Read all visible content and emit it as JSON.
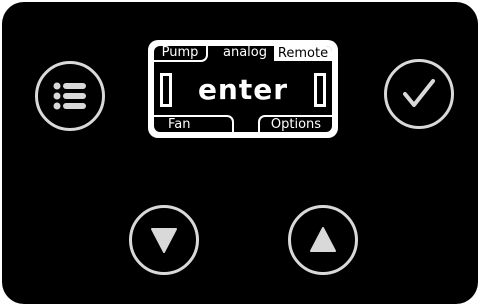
{
  "display": {
    "tabs_top": {
      "left": "Pump",
      "center": "analog",
      "right": "Remote"
    },
    "main_text": "enter",
    "tabs_bottom": {
      "left": "Fan",
      "right": "Options"
    }
  },
  "buttons": {
    "menu": {
      "icon": "menu-list-icon"
    },
    "confirm": {
      "icon": "checkmark-icon"
    },
    "down": {
      "icon": "triangle-down-icon"
    },
    "up": {
      "icon": "triangle-up-icon"
    }
  },
  "colors": {
    "panel": "#000000",
    "button_ring": "#d9d9d9",
    "lcd_frame": "#ffffff",
    "lcd_background": "#000000",
    "lcd_text": "#ffffff"
  }
}
